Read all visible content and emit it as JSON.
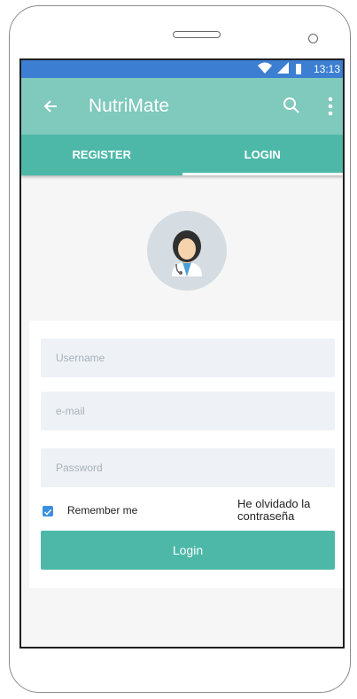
{
  "status_bar": {
    "time": "13:13"
  },
  "app_bar": {
    "title": "NutriMate"
  },
  "tabs": [
    {
      "label": "REGISTER"
    },
    {
      "label": "LOGIN"
    }
  ],
  "form": {
    "username_placeholder": "Username",
    "email_placeholder": "e-mail",
    "password_placeholder": "Password",
    "remember_label": "Remember me",
    "remember_checked": true,
    "forgot_label": "He olvidado la contraseña",
    "login_button": "Login"
  },
  "colors": {
    "status_bar": "#3c7fd2",
    "app_bar": "#7fc9bd",
    "tabs": "#4db8a8",
    "accent": "#4db8a8",
    "checkbox": "#3c8fe0"
  },
  "icons": [
    "back-arrow-icon",
    "search-icon",
    "more-vert-icon",
    "wifi-icon",
    "signal-icon",
    "battery-icon",
    "doctor-avatar"
  ]
}
